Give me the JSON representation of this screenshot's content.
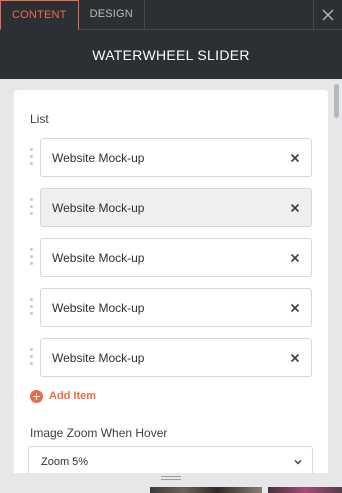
{
  "tabs": [
    {
      "label": "CONTENT",
      "active": true
    },
    {
      "label": "DESIGN",
      "active": false
    }
  ],
  "panel_title": "WATERWHEEL SLIDER",
  "list": {
    "label": "List",
    "items": [
      {
        "label": "Website Mock-up"
      },
      {
        "label": "Website Mock-up"
      },
      {
        "label": "Website Mock-up"
      },
      {
        "label": "Website Mock-up"
      },
      {
        "label": "Website Mock-up"
      }
    ],
    "add_label": "Add Item"
  },
  "zoom": {
    "label": "Image Zoom When Hover",
    "selected": "Zoom 5%"
  },
  "colors": {
    "accent": "#ef6a4a",
    "header_bg": "#2c3034",
    "panel_bg": "#e6e7e9"
  },
  "icons": {
    "close": "close-icon",
    "remove": "remove-icon",
    "drag": "drag-handle-icon",
    "add": "plus-circle-icon",
    "chevron": "chevron-down-icon"
  }
}
